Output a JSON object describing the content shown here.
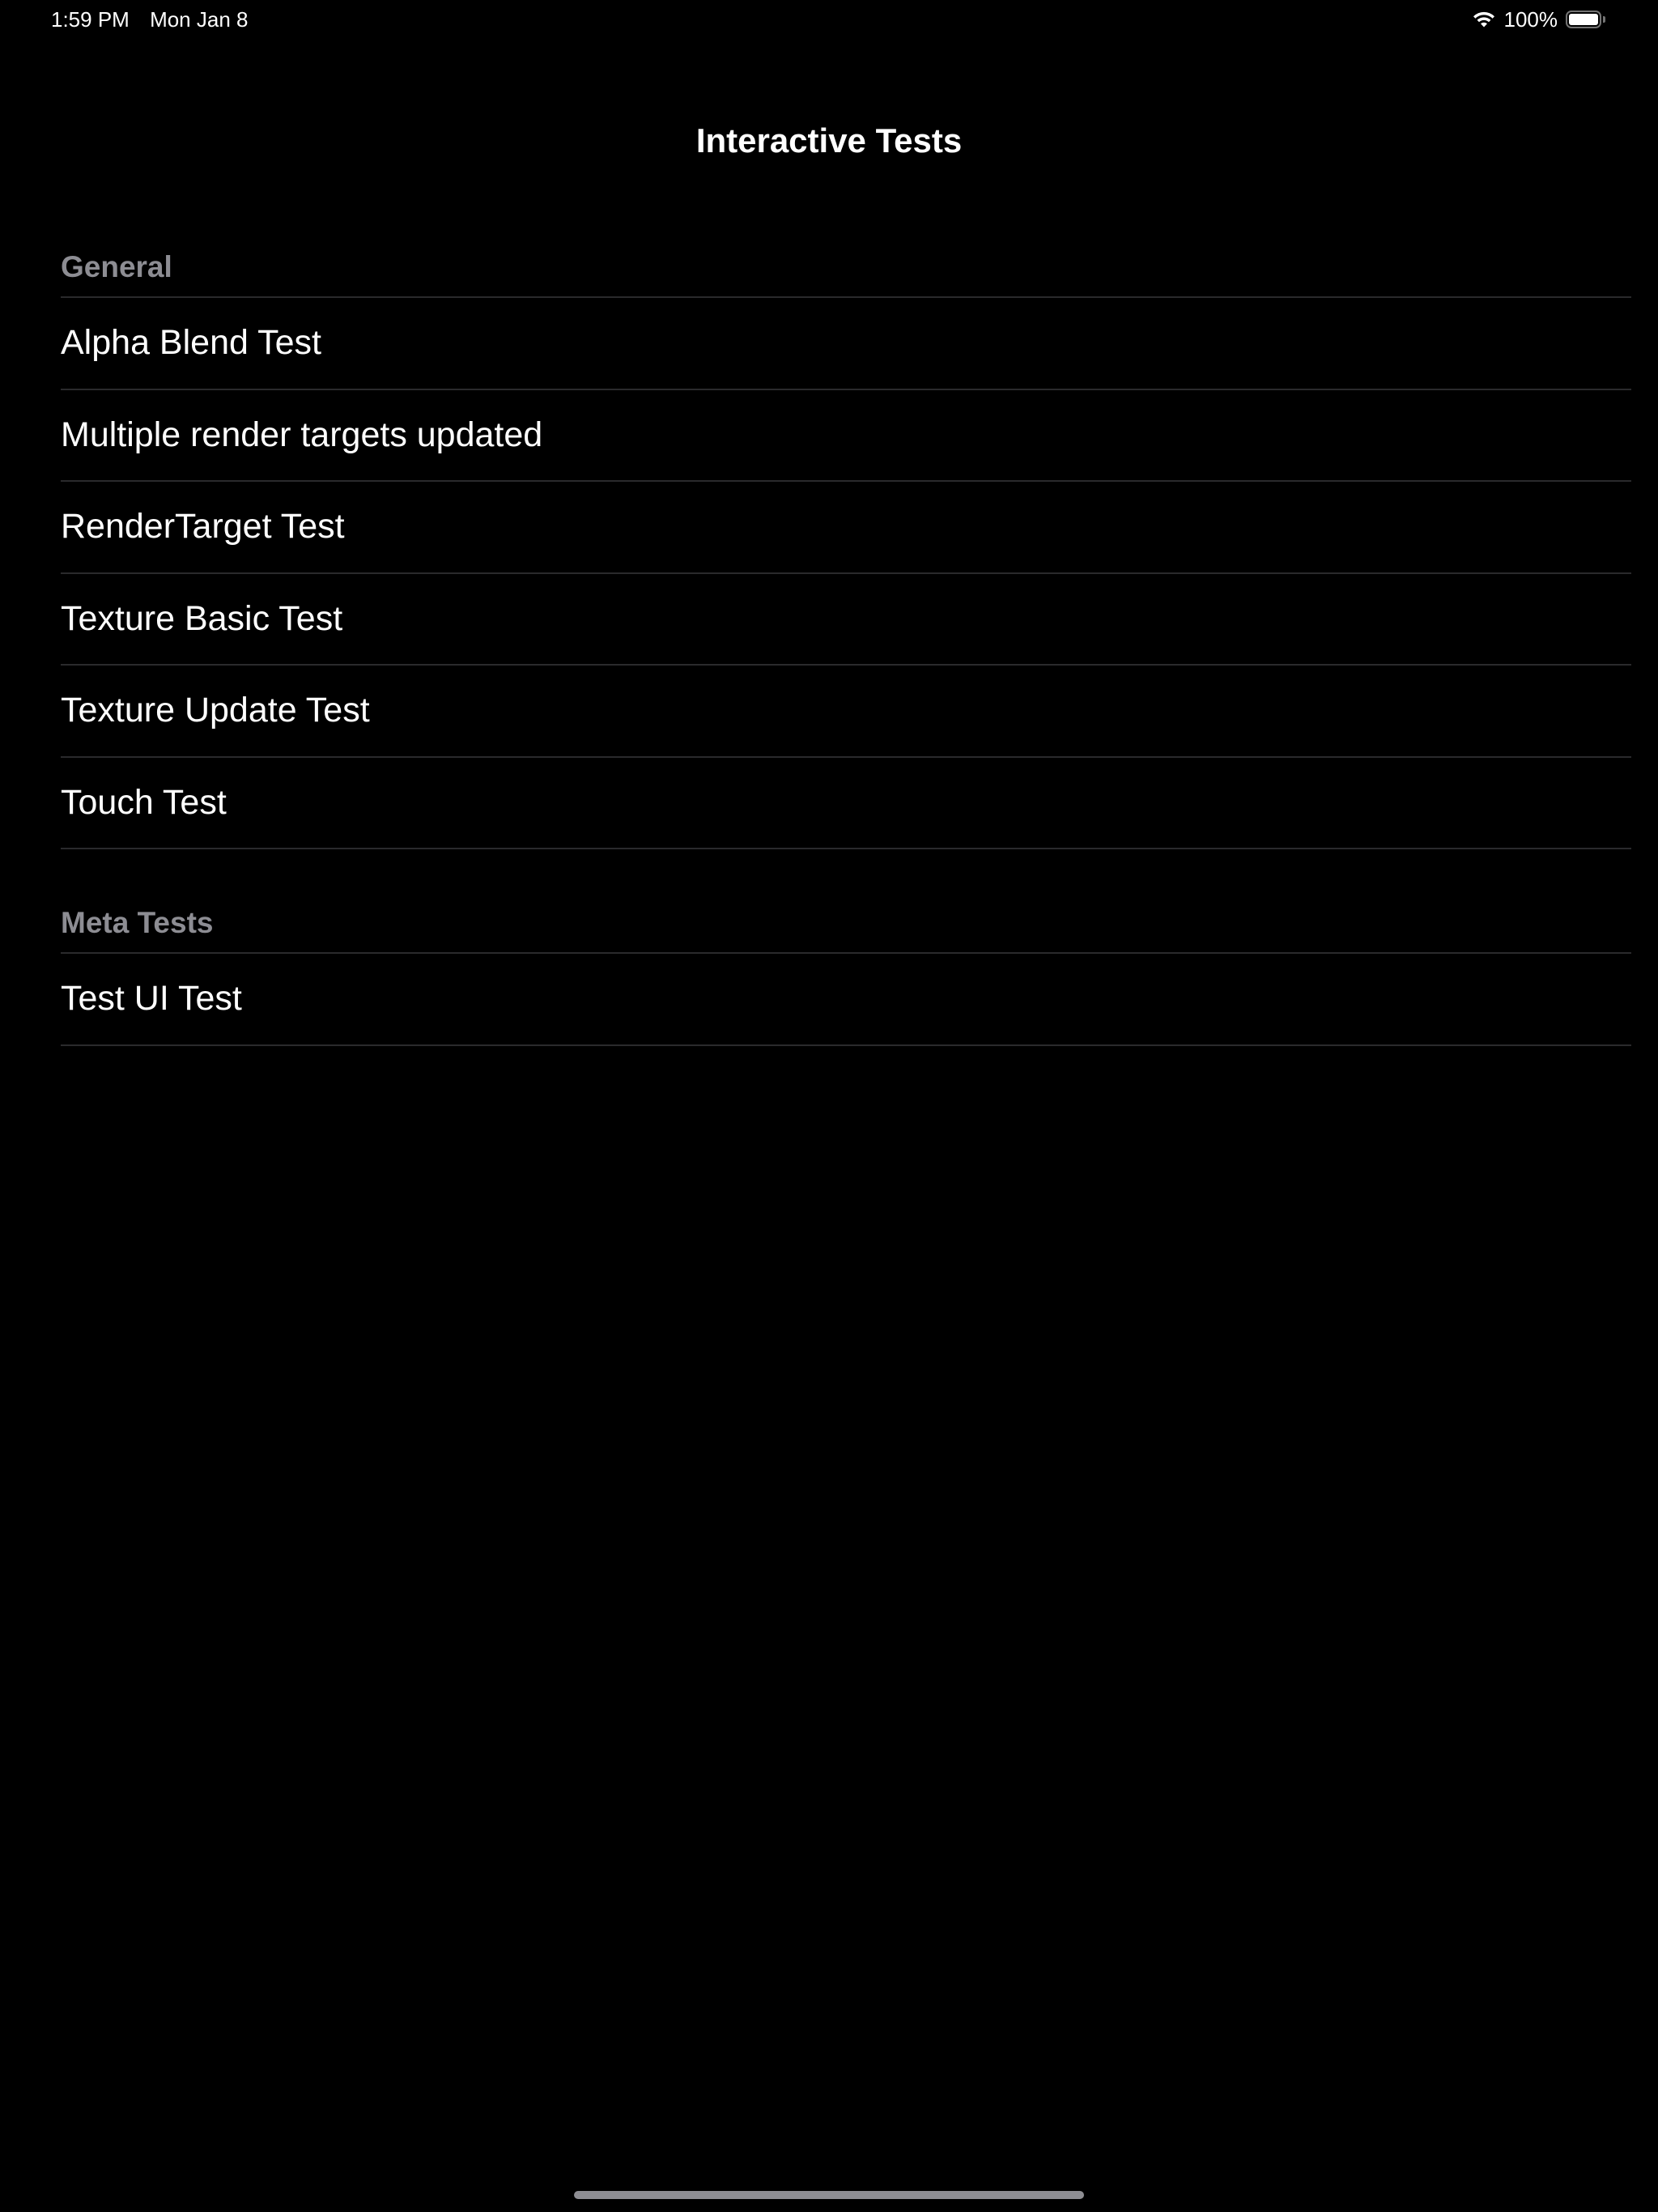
{
  "status_bar": {
    "time": "1:59 PM",
    "date": "Mon Jan 8",
    "battery_percent": "100%",
    "battery_level": 1.0,
    "icons": [
      "wifi-icon",
      "battery-icon"
    ]
  },
  "nav": {
    "title": "Interactive Tests"
  },
  "sections": [
    {
      "header": "General",
      "items": [
        {
          "label": "Alpha Blend Test"
        },
        {
          "label": "Multiple render targets updated"
        },
        {
          "label": "RenderTarget Test"
        },
        {
          "label": "Texture Basic Test"
        },
        {
          "label": "Texture Update Test"
        },
        {
          "label": "Touch Test"
        }
      ]
    },
    {
      "header": "Meta Tests",
      "items": [
        {
          "label": "Test UI Test"
        }
      ]
    }
  ],
  "colors": {
    "background": "#000000",
    "text": "#ffffff",
    "section_header": "#8d8d93",
    "separator": "#2a2a2c",
    "home_indicator": "#8e8e93"
  }
}
